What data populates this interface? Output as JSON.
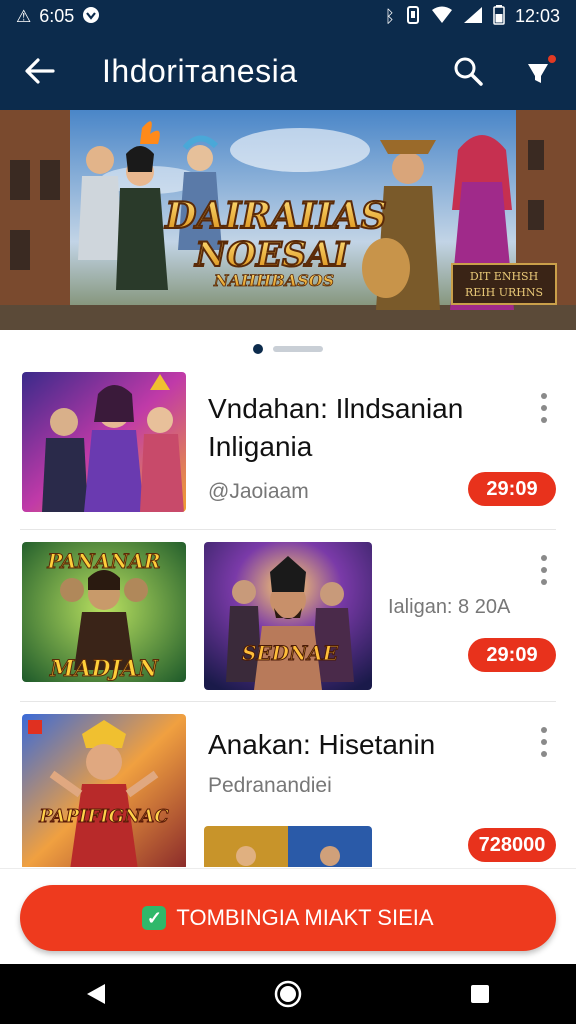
{
  "status_bar": {
    "time_left": "6:05",
    "time_right": "12:03"
  },
  "app_bar": {
    "title": "Ihdoriтanesia"
  },
  "banner": {
    "title_line1": "DAIRAIIAS",
    "title_line2": "NOESAI",
    "title_line3": "NAHHBASOS",
    "sign_line1": "DIT ENHSH",
    "sign_line2": "REIH URHNS"
  },
  "list": {
    "items": [
      {
        "title_line1": "Vndahan: Ilndsanian",
        "title_line2": "Inligania",
        "subtitle": "@Jaoiaam",
        "price": "29:09",
        "thumb_caption": ""
      },
      {
        "title_line1": "",
        "title_line2": "",
        "subtitle": "Ialigan: 8 20A",
        "price": "29:09",
        "thumb_caption": "PANANAR",
        "thumb_caption2": "MADJAN",
        "thumb2_caption": "SEDNAE"
      },
      {
        "title_line1": "Anakan: Hisetanin",
        "title_line2": "",
        "subtitle": "Pedranandiei",
        "price": "728000",
        "thumb_caption": "PAPIFIGNAC"
      }
    ]
  },
  "cta": {
    "label": "TOMBINGIA MIAKT SIEIA"
  },
  "colors": {
    "primary": "#0c2b4c",
    "accent": "#ee3a1e",
    "price": "#e8321c"
  }
}
